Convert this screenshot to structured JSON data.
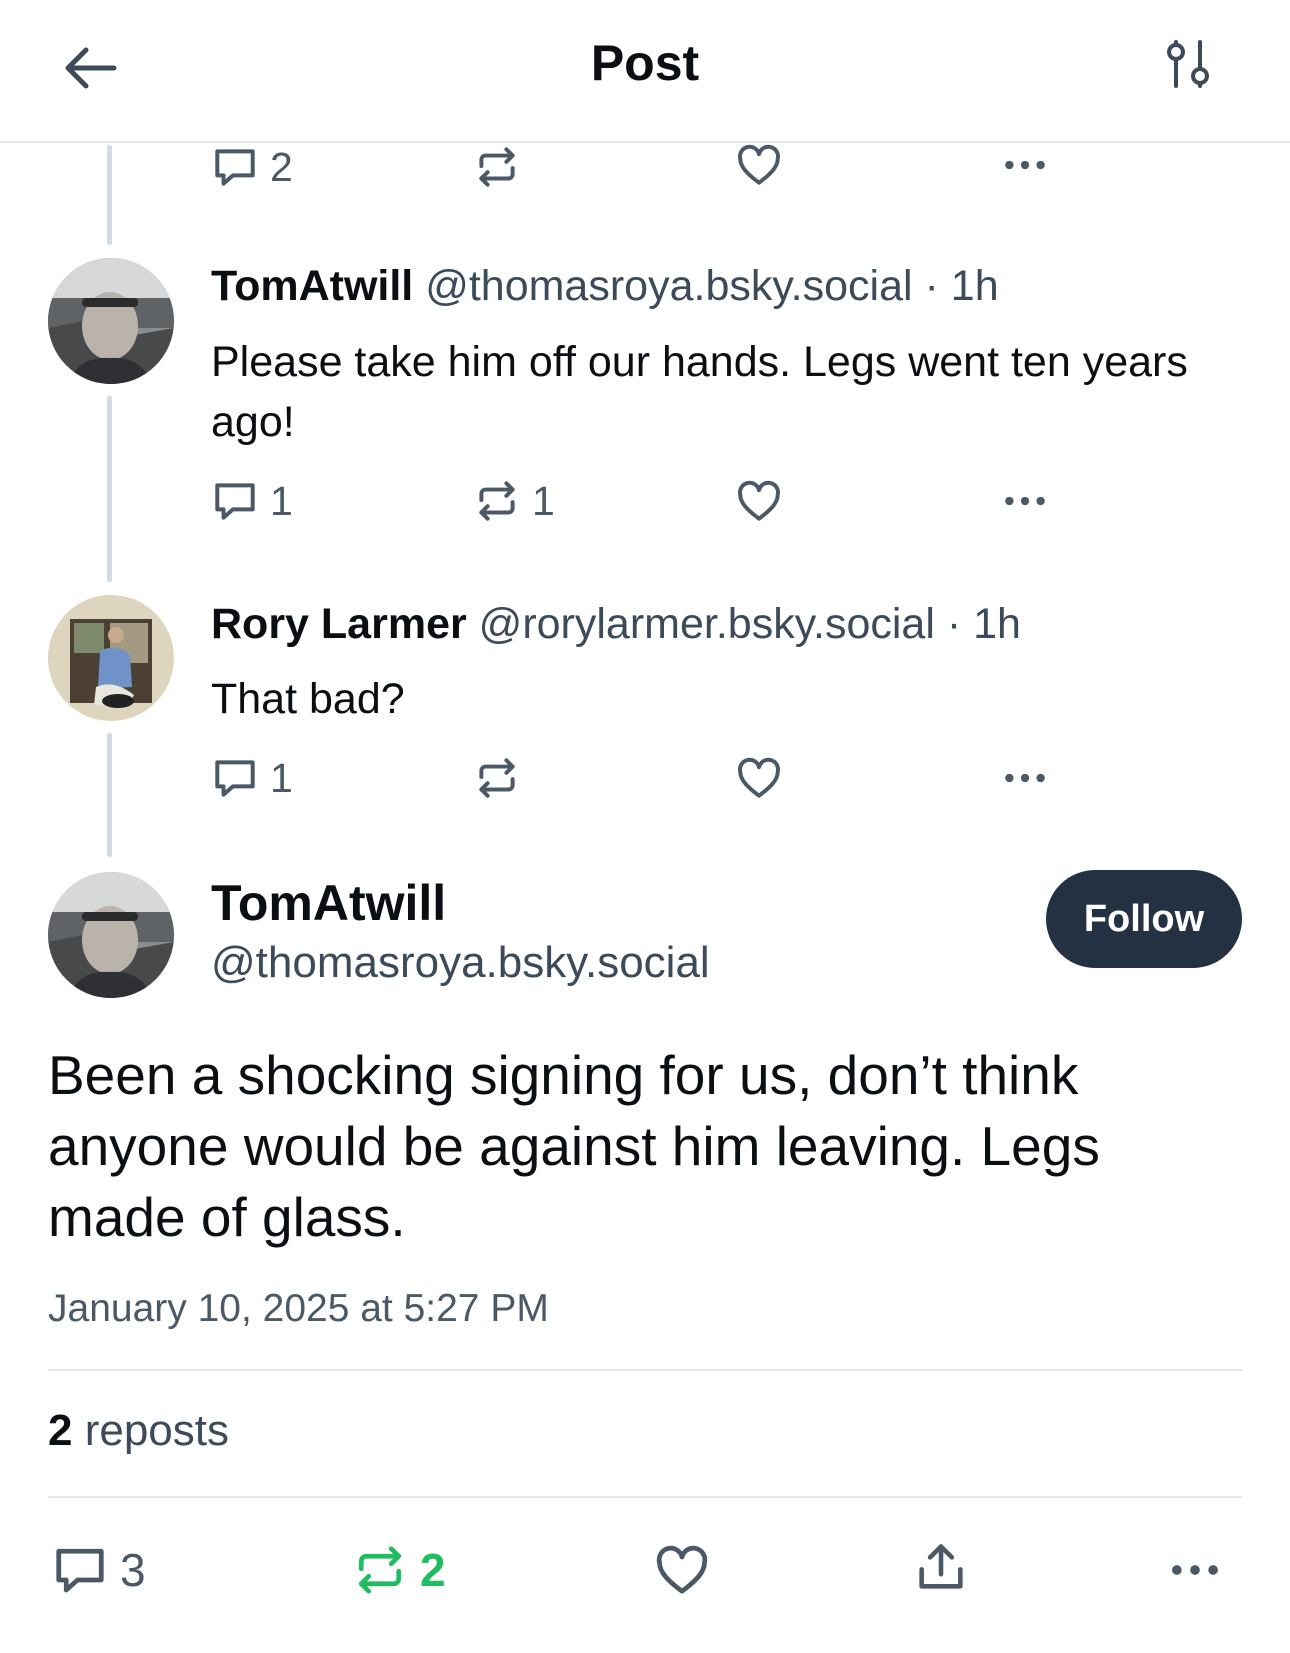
{
  "header": {
    "title": "Post",
    "back_icon": "arrow-left-icon",
    "filter_icon": "sliders-icon"
  },
  "colors": {
    "text": "#0b0f14",
    "muted": "#4b5967",
    "divider": "#e4e8ec",
    "follow_button": "#233142",
    "repost_active": "#20bc62"
  },
  "replies": [
    {
      "reply_count": "2",
      "repost_count": "",
      "like_count": ""
    },
    {
      "author": "TomAtwill",
      "handle": "@thomasroya.bsky.social",
      "time": " · 1h",
      "text": "Please take him off our hands. Legs went ten years ago!",
      "reply_count": "1",
      "repost_count": "1",
      "like_count": ""
    },
    {
      "author": "Rory Larmer",
      "handle": "@rorylarmer.bsky.social",
      "time": " · 1h",
      "text": "That bad?",
      "reply_count": "1",
      "repost_count": "",
      "like_count": ""
    }
  ],
  "main_post": {
    "author": "TomAtwill",
    "handle": "@thomasroya.bsky.social",
    "follow_label": "Follow",
    "text": "Been a shocking signing for us, don’t think anyone would be against him leaving. Legs made of glass.",
    "timestamp": "January 10, 2025 at 5:27 PM",
    "repost_total": "2",
    "repost_word": " reposts",
    "reply_count": "3",
    "repost_count": "2",
    "like_count": ""
  }
}
